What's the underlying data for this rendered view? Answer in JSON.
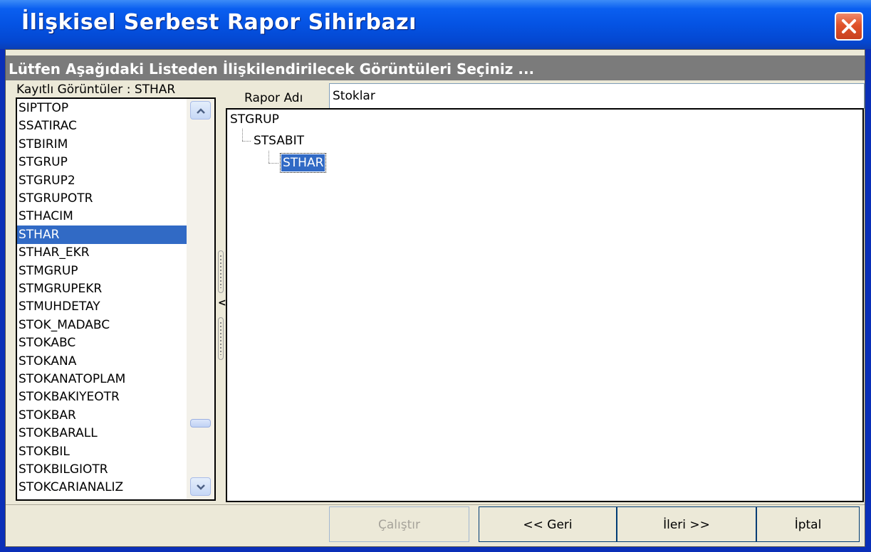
{
  "window": {
    "title": "İlişkisel Serbest Rapor Sihirbazı",
    "close_icon": "close-icon"
  },
  "subheader": "Lütfen Aşağıdaki Listeden İlişkilendirilecek Görüntüleri Seçiniz ...",
  "list": {
    "label": "Kayıtlı Görüntüler : STHAR",
    "selected": "STHAR",
    "items": [
      "SIPTTOP",
      "SSATIRAC",
      "STBIRIM",
      "STGRUP",
      "STGRUP2",
      "STGRUPOTR",
      "STHACIM",
      "STHAR",
      "STHAR_EKR",
      "STMGRUP",
      "STMGRUPEKR",
      "STMUHDETAY",
      "STOK_MADABC",
      "STOKABC",
      "STOKANA",
      "STOKANATOPLAM",
      "STOKBAKIYEOTR",
      "STOKBAR",
      "STOKBARALL",
      "STOKBIL",
      "STOKBILGIOTR",
      "STOKCARIANALIZ"
    ]
  },
  "report": {
    "name_label": "Rapor Adı",
    "name_value": "Stoklar"
  },
  "tree": {
    "root": "STGRUP",
    "child": "STSABIT",
    "grandchild": "STHAR"
  },
  "buttons": {
    "run": "Çalıştır",
    "back": "<< Geri",
    "next": "İleri >>",
    "cancel": "İptal"
  },
  "colors": {
    "title_bar": "#0553e3",
    "selection": "#316ac5",
    "close_button": "#e0522a",
    "dialog_bg": "#ece9d8"
  }
}
